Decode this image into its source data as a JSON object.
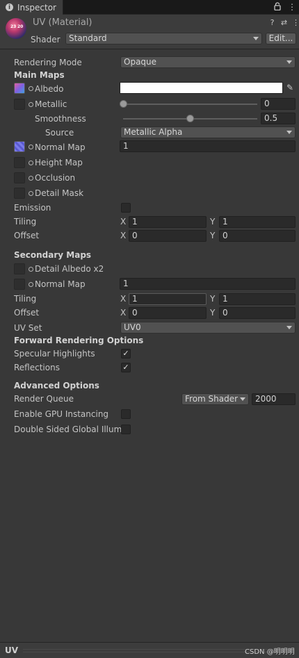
{
  "tab": {
    "title": "Inspector"
  },
  "header": {
    "title": "UV (Material)",
    "shader_label": "Shader",
    "shader_value": "Standard",
    "edit_label": "Edit...",
    "icons": [
      "help-icon",
      "preset-icon",
      "kebab-menu-icon"
    ]
  },
  "rendering_mode": {
    "label": "Rendering Mode",
    "value": "Opaque"
  },
  "main_maps": {
    "heading": "Main Maps",
    "albedo": {
      "label": "Albedo",
      "color": "#ffffff"
    },
    "metallic": {
      "label": "Metallic",
      "value": "0",
      "level": 0
    },
    "smoothness": {
      "label": "Smoothness",
      "value": "0.5",
      "level": 0.5
    },
    "source": {
      "label": "Source",
      "value": "Metallic Alpha"
    },
    "normal_map": {
      "label": "Normal Map",
      "value": "1"
    },
    "height_map": {
      "label": "Height Map"
    },
    "occlusion": {
      "label": "Occlusion"
    },
    "detail_mask": {
      "label": "Detail Mask"
    },
    "emission": {
      "label": "Emission",
      "checked": false
    },
    "tiling": {
      "label": "Tiling",
      "x_label": "X",
      "x": "1",
      "y_label": "Y",
      "y": "1"
    },
    "offset": {
      "label": "Offset",
      "x_label": "X",
      "x": "0",
      "y_label": "Y",
      "y": "0"
    }
  },
  "secondary_maps": {
    "heading": "Secondary Maps",
    "detail_albedo": {
      "label": "Detail Albedo x2"
    },
    "normal_map": {
      "label": "Normal Map",
      "value": "1"
    },
    "tiling": {
      "label": "Tiling",
      "x_label": "X",
      "x": "1",
      "y_label": "Y",
      "y": "1"
    },
    "offset": {
      "label": "Offset",
      "x_label": "X",
      "x": "0",
      "y_label": "Y",
      "y": "0"
    },
    "uv_set": {
      "label": "UV Set",
      "value": "UV0"
    }
  },
  "forward_rendering": {
    "heading": "Forward Rendering Options",
    "specular": {
      "label": "Specular Highlights",
      "checked": true,
      "mark": "✓"
    },
    "reflections": {
      "label": "Reflections",
      "checked": true,
      "mark": "✓"
    }
  },
  "advanced": {
    "heading": "Advanced Options",
    "render_queue": {
      "label": "Render Queue",
      "dropdown": "From Shader",
      "value": "2000"
    },
    "gpu_instancing": {
      "label": "Enable GPU Instancing",
      "checked": false
    },
    "double_sided": {
      "label": "Double Sided Global Illumin",
      "checked": false
    }
  },
  "footer": {
    "title": "UV",
    "watermark": "CSDN @明明明"
  },
  "sphere": {
    "n1": "23",
    "n2": "20"
  }
}
